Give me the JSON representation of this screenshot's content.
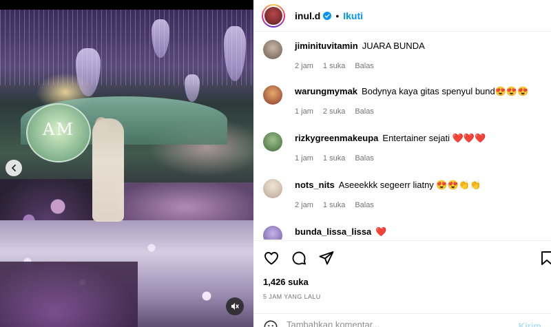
{
  "post": {
    "username": "inul.d",
    "follow_label": "Ikuti",
    "separator": "•",
    "avatar_color": "#8a2c30"
  },
  "media": {
    "monogram": "AM"
  },
  "comments": [
    {
      "user": "jiminituvitamin",
      "text": "JUARA BUNDA",
      "time": "2 jam",
      "likes": "1 suka",
      "reply": "Balas"
    },
    {
      "user": "warungmymak",
      "text": "Bodynya kaya gitas spenyul bund😍😍😍",
      "time": "1 jam",
      "likes": "2 suka",
      "reply": "Balas"
    },
    {
      "user": "rizkygreenmakeupa",
      "text": "Entertainer sejati ❤️❤️❤️",
      "time": "1 jam",
      "likes": "1 suka",
      "reply": "Balas"
    },
    {
      "user": "nots_nits",
      "text": "Aseeekkk segeerr liatny 😍😍👏👏",
      "time": "2 jam",
      "likes": "1 suka",
      "reply": "Balas"
    },
    {
      "user": "bunda_lissa_lissa",
      "text": "❤️"
    }
  ],
  "footer": {
    "likes": "1,426 suka",
    "time_ago": "5 JAM YANG LALU",
    "add_comment_placeholder": "Tambahkan komentar...",
    "post_label": "Kirim"
  },
  "icons": {
    "verified": "verified-badge-icon",
    "like": "heart-icon",
    "comment": "comment-icon",
    "share": "share-icon",
    "save": "bookmark-icon",
    "emoji": "emoji-icon",
    "prev": "chevron-left-icon",
    "mute": "speaker-muted-icon"
  },
  "colors": {
    "accent": "#0095f6",
    "muted_text": "#737373",
    "heart": "#e0245e"
  }
}
